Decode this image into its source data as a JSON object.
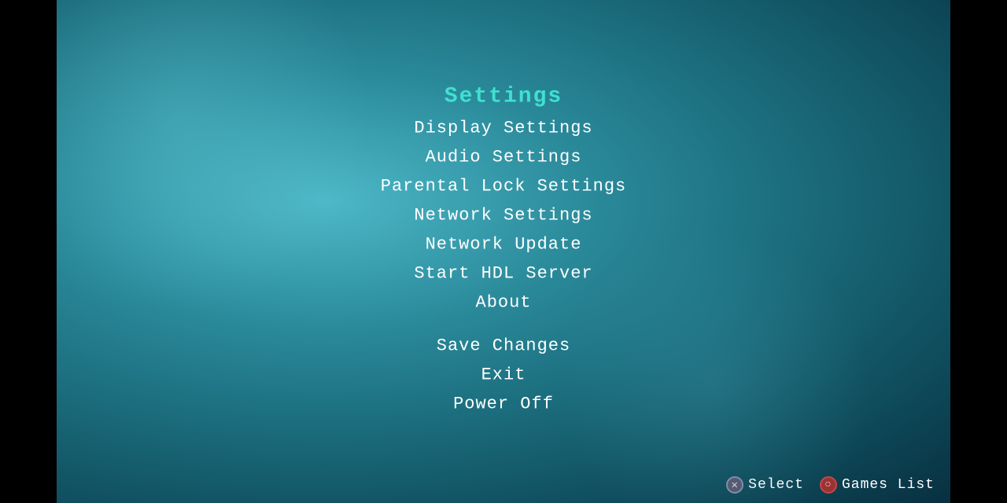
{
  "screen": {
    "background_color": "#1a7a8a"
  },
  "menu": {
    "title": "Settings",
    "items": [
      {
        "label": "Display Settings",
        "id": "display-settings"
      },
      {
        "label": "Audio Settings",
        "id": "audio-settings"
      },
      {
        "label": "Parental Lock Settings",
        "id": "parental-lock-settings"
      },
      {
        "label": "Network Settings",
        "id": "network-settings"
      },
      {
        "label": "Network Update",
        "id": "network-update"
      },
      {
        "label": "Start HDL Server",
        "id": "start-hdl-server"
      },
      {
        "label": "About",
        "id": "about"
      }
    ],
    "actions": [
      {
        "label": "Save Changes",
        "id": "save-changes"
      },
      {
        "label": "Exit",
        "id": "exit"
      },
      {
        "label": "Power Off",
        "id": "power-off"
      }
    ]
  },
  "bottom_bar": {
    "select_label": "Select",
    "games_list_label": "Games List",
    "x_icon": "✕",
    "o_icon": "○"
  }
}
